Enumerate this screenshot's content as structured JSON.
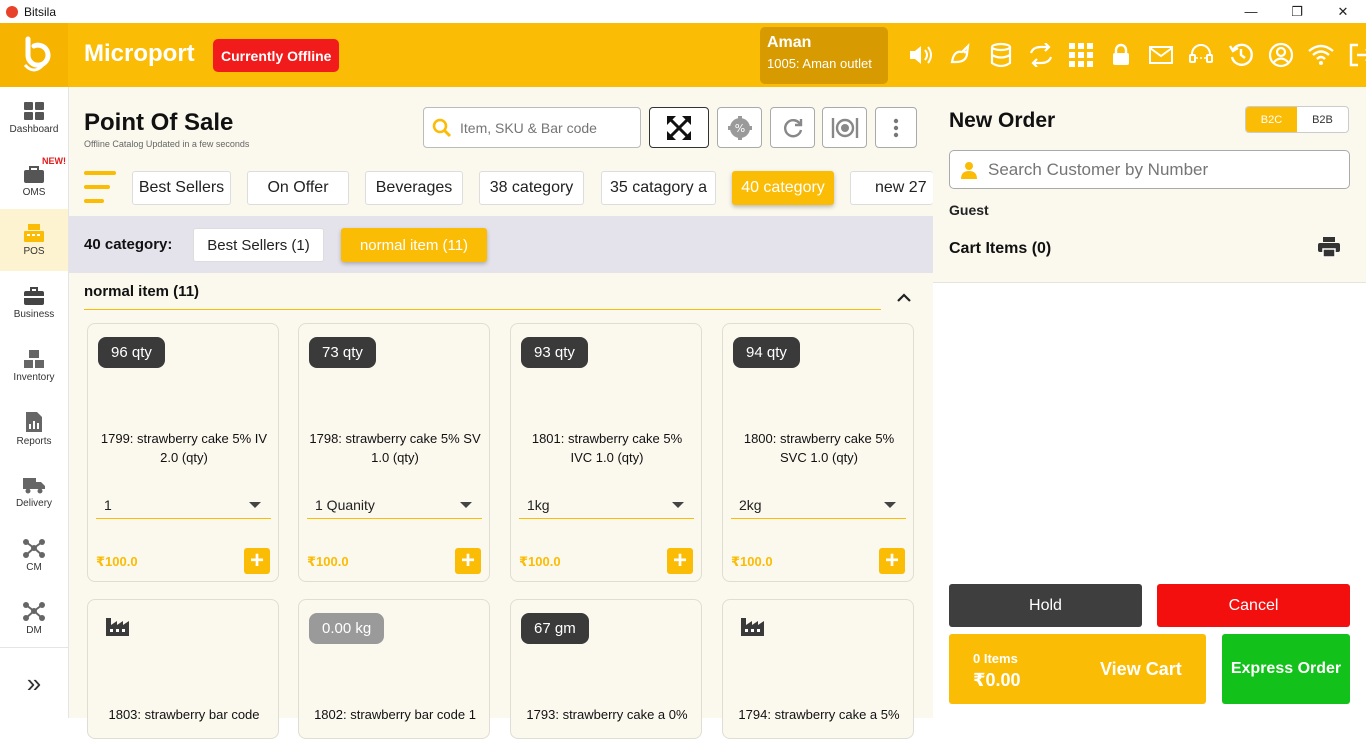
{
  "window": {
    "title": "Bitsila"
  },
  "header": {
    "brand": "Microport",
    "offline_badge": "Currently Offline",
    "user_name": "Aman",
    "user_outlet": "1005: Aman outlet",
    "accent_color": "#fbbc05"
  },
  "sidebar": {
    "items": [
      {
        "label": "Dashboard",
        "icon": "dashboard-icon"
      },
      {
        "label": "OMS",
        "icon": "oms-icon",
        "tag": "NEW!"
      },
      {
        "label": "POS",
        "icon": "pos-icon"
      },
      {
        "label": "Business",
        "icon": "briefcase-icon"
      },
      {
        "label": "Inventory",
        "icon": "boxes-icon"
      },
      {
        "label": "Reports",
        "icon": "report-icon"
      },
      {
        "label": "Delivery",
        "icon": "truck-icon"
      },
      {
        "label": "CM",
        "icon": "network-icon"
      },
      {
        "label": "DM",
        "icon": "network-icon"
      }
    ],
    "expand_glyph": "»"
  },
  "pos": {
    "title": "Point Of Sale",
    "subtitle": "Offline Catalog Updated in a few seconds",
    "search_placeholder": "Item, SKU & Bar code"
  },
  "categories": [
    {
      "label": "Best Sellers"
    },
    {
      "label": "On Offer"
    },
    {
      "label": "Beverages"
    },
    {
      "label": "38 category"
    },
    {
      "label": "35 catagory a"
    },
    {
      "label": "40 category",
      "active": true
    },
    {
      "label": "new 27"
    }
  ],
  "subcategory": {
    "label": "40 category:",
    "items": [
      {
        "label": "Best Sellers (1)"
      },
      {
        "label": "normal item (11)",
        "active": true
      }
    ]
  },
  "section": {
    "title": "normal item (11)"
  },
  "products": [
    {
      "badge": "96 qty",
      "name": "1799: strawberry cake 5% IV 2.0 (qty)",
      "unit": "1",
      "price": "₹100.0"
    },
    {
      "badge": "73 qty",
      "name": "1798: strawberry cake 5% SV 1.0 (qty)",
      "unit": "1 Quanity",
      "price": "₹100.0"
    },
    {
      "badge": "93 qty",
      "name": "1801: strawberry cake 5% IVC 1.0 (qty)",
      "unit": "1kg",
      "price": "₹100.0"
    },
    {
      "badge": "94 qty",
      "name": "1800: strawberry cake 5% SVC 1.0 (qty)",
      "unit": "2kg",
      "price": "₹100.0"
    },
    {
      "badge": "",
      "name": "1803: strawberry bar code",
      "icon": "factory-icon"
    },
    {
      "badge": "0.00 kg",
      "name": "1802: strawberry bar code 1"
    },
    {
      "badge": "67 gm",
      "name": "1793: strawberry cake a 0%"
    },
    {
      "badge": "",
      "name": "1794: strawberry cake a 5%",
      "icon": "factory-icon"
    }
  ],
  "order": {
    "title": "New Order",
    "b2c": "B2C",
    "b2b": "B2B",
    "customer_placeholder": "Search Customer by Number",
    "guest": "Guest",
    "cart_items": "Cart Items (0)",
    "hold": "Hold",
    "cancel": "Cancel",
    "items_count": "0 Items",
    "total": "₹0.00",
    "view_cart": "View Cart",
    "express": "Express Order"
  }
}
